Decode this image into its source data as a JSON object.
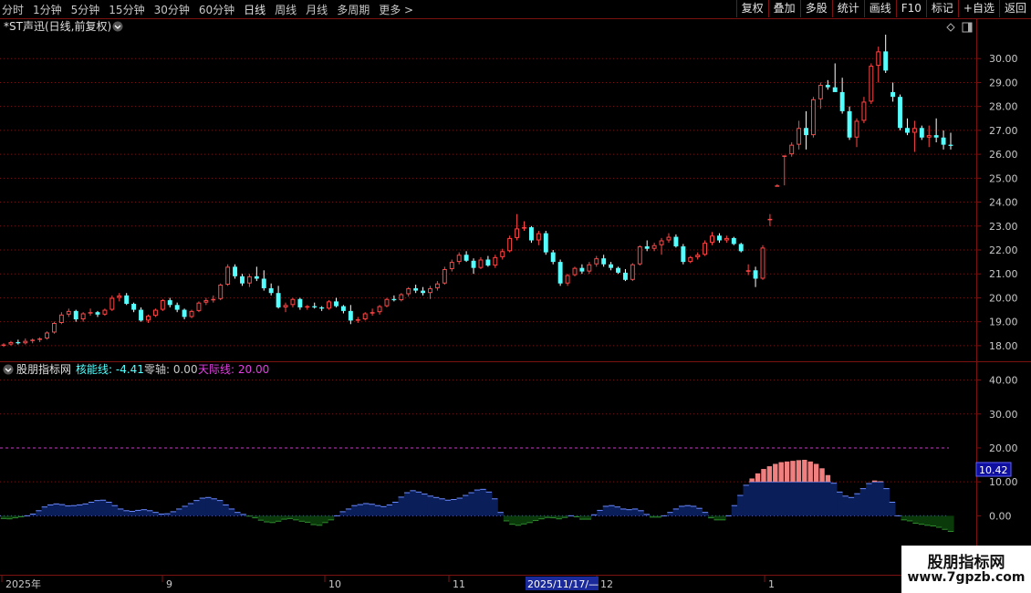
{
  "toolbar": {
    "periods": [
      "分时",
      "1分钟",
      "5分钟",
      "15分钟",
      "30分钟",
      "60分钟",
      "日线",
      "周线",
      "月线",
      "多周期",
      "更多"
    ],
    "active_period": "日线",
    "more_arrow": "更多 >",
    "buttons": [
      "复权",
      "叠加",
      "多股",
      "统计",
      "画线",
      "F10",
      "标记",
      "+自选",
      "返回"
    ]
  },
  "price_panel": {
    "title": "*ST声迅(日线,前复权)",
    "y_ticks": [
      "30.00",
      "29.00",
      "28.00",
      "27.00",
      "26.00",
      "25.00",
      "24.00",
      "23.00",
      "22.00",
      "21.00",
      "20.00",
      "19.00",
      "18.00"
    ]
  },
  "indicator_panel": {
    "name": "股朋指标网",
    "line1_label": "核能线: -4.41",
    "line2_label": "零轴: 0.00",
    "line3_label": "天际线: 20.00",
    "y_ticks": [
      "40.00",
      "30.00",
      "20.00",
      "10.00",
      "0.00"
    ],
    "current_value": "10.42"
  },
  "date_axis": {
    "labels": [
      "2025年",
      "9",
      "10",
      "11",
      "12",
      "1"
    ],
    "cursor_label": "2025/11/17/—"
  },
  "watermark": {
    "line1": "股朋指标网",
    "line2": "www.7gpzb.com"
  },
  "colors": {
    "up": "#ff4646",
    "down": "#54ffff",
    "grid": "#7a1212",
    "skyline": "#c040c0",
    "positive_fill": "#0a1e5a",
    "green_fill": "#0a3a0a",
    "pink": "#f08080"
  },
  "chart_data": {
    "type": "candlestick",
    "x_start_label": "2025年",
    "ylim": [
      17.5,
      31.0
    ],
    "ohlc": [
      [
        18.0,
        18.1,
        17.95,
        18.05
      ],
      [
        18.05,
        18.2,
        18.0,
        18.15
      ],
      [
        18.15,
        18.25,
        18.05,
        18.1
      ],
      [
        18.1,
        18.3,
        18.05,
        18.2
      ],
      [
        18.2,
        18.3,
        18.1,
        18.25
      ],
      [
        18.25,
        18.35,
        18.15,
        18.3
      ],
      [
        18.3,
        18.6,
        18.25,
        18.55
      ],
      [
        18.55,
        19.0,
        18.5,
        18.95
      ],
      [
        18.95,
        19.4,
        18.9,
        19.3
      ],
      [
        19.3,
        19.55,
        19.2,
        19.45
      ],
      [
        19.45,
        19.5,
        19.0,
        19.1
      ],
      [
        19.1,
        19.4,
        19.0,
        19.35
      ],
      [
        19.35,
        19.55,
        19.25,
        19.4
      ],
      [
        19.4,
        19.45,
        19.2,
        19.3
      ],
      [
        19.3,
        19.55,
        19.25,
        19.5
      ],
      [
        19.5,
        20.1,
        19.45,
        20.0
      ],
      [
        20.0,
        20.2,
        19.85,
        20.1
      ],
      [
        20.1,
        20.2,
        19.7,
        19.75
      ],
      [
        19.75,
        19.8,
        19.4,
        19.5
      ],
      [
        19.5,
        19.6,
        19.0,
        19.05
      ],
      [
        19.05,
        19.3,
        18.95,
        19.25
      ],
      [
        19.25,
        19.55,
        19.2,
        19.5
      ],
      [
        19.5,
        19.95,
        19.45,
        19.9
      ],
      [
        19.9,
        20.0,
        19.6,
        19.7
      ],
      [
        19.7,
        19.8,
        19.4,
        19.5
      ],
      [
        19.5,
        19.55,
        19.1,
        19.2
      ],
      [
        19.2,
        19.5,
        19.15,
        19.45
      ],
      [
        19.45,
        19.85,
        19.4,
        19.8
      ],
      [
        19.8,
        20.0,
        19.7,
        19.9
      ],
      [
        19.9,
        20.1,
        19.8,
        19.95
      ],
      [
        19.95,
        20.6,
        19.9,
        20.55
      ],
      [
        20.55,
        21.4,
        20.5,
        21.3
      ],
      [
        21.3,
        21.4,
        20.8,
        20.9
      ],
      [
        20.9,
        21.0,
        20.5,
        20.6
      ],
      [
        20.6,
        21.0,
        20.45,
        20.9
      ],
      [
        20.9,
        21.3,
        20.7,
        20.8
      ],
      [
        20.8,
        21.15,
        20.3,
        20.4
      ],
      [
        20.4,
        20.6,
        20.1,
        20.2
      ],
      [
        20.2,
        20.5,
        19.55,
        19.6
      ],
      [
        19.6,
        19.8,
        19.4,
        19.7
      ],
      [
        19.7,
        20.0,
        19.6,
        19.95
      ],
      [
        19.95,
        20.0,
        19.5,
        19.6
      ],
      [
        19.6,
        19.7,
        19.5,
        19.65
      ],
      [
        19.65,
        19.8,
        19.55,
        19.6
      ],
      [
        19.6,
        19.65,
        19.45,
        19.55
      ],
      [
        19.55,
        19.9,
        19.5,
        19.85
      ],
      [
        19.85,
        20.0,
        19.6,
        19.65
      ],
      [
        19.65,
        19.7,
        19.35,
        19.45
      ],
      [
        19.45,
        19.7,
        18.9,
        19.05
      ],
      [
        19.05,
        19.2,
        18.95,
        19.1
      ],
      [
        19.1,
        19.4,
        19.05,
        19.35
      ],
      [
        19.35,
        19.55,
        19.25,
        19.4
      ],
      [
        19.4,
        19.7,
        19.3,
        19.65
      ],
      [
        19.65,
        20.0,
        19.6,
        19.95
      ],
      [
        19.95,
        20.1,
        19.85,
        19.9
      ],
      [
        19.9,
        20.2,
        19.85,
        20.15
      ],
      [
        20.15,
        20.45,
        20.05,
        20.4
      ],
      [
        20.4,
        20.55,
        20.2,
        20.3
      ],
      [
        20.3,
        20.45,
        20.1,
        20.2
      ],
      [
        20.2,
        20.5,
        19.95,
        20.4
      ],
      [
        20.4,
        20.7,
        20.3,
        20.6
      ],
      [
        20.6,
        21.3,
        20.55,
        21.2
      ],
      [
        21.2,
        21.6,
        21.1,
        21.5
      ],
      [
        21.5,
        21.9,
        21.4,
        21.8
      ],
      [
        21.8,
        21.95,
        21.5,
        21.55
      ],
      [
        21.55,
        21.65,
        21.0,
        21.25
      ],
      [
        21.25,
        21.7,
        21.2,
        21.6
      ],
      [
        21.6,
        21.75,
        21.3,
        21.35
      ],
      [
        21.35,
        21.8,
        21.25,
        21.7
      ],
      [
        21.7,
        22.05,
        21.6,
        21.95
      ],
      [
        21.95,
        22.6,
        21.9,
        22.5
      ],
      [
        22.5,
        23.5,
        22.4,
        22.9
      ],
      [
        22.9,
        23.2,
        22.8,
        22.95
      ],
      [
        22.95,
        23.0,
        22.3,
        22.4
      ],
      [
        22.4,
        22.8,
        22.2,
        22.7
      ],
      [
        22.7,
        22.8,
        21.8,
        21.9
      ],
      [
        21.9,
        22.0,
        21.4,
        21.5
      ],
      [
        21.5,
        21.6,
        20.5,
        20.6
      ],
      [
        20.6,
        21.0,
        20.5,
        20.95
      ],
      [
        20.95,
        21.3,
        20.9,
        21.25
      ],
      [
        21.25,
        21.4,
        21.0,
        21.1
      ],
      [
        21.1,
        21.5,
        21.0,
        21.4
      ],
      [
        21.4,
        21.75,
        21.3,
        21.65
      ],
      [
        21.65,
        21.8,
        21.3,
        21.4
      ],
      [
        21.4,
        21.5,
        21.15,
        21.25
      ],
      [
        21.25,
        21.3,
        21.0,
        21.05
      ],
      [
        21.05,
        21.2,
        20.7,
        20.75
      ],
      [
        20.75,
        21.45,
        20.7,
        21.4
      ],
      [
        21.4,
        22.2,
        21.35,
        22.15
      ],
      [
        22.15,
        22.4,
        21.95,
        22.05
      ],
      [
        22.05,
        22.3,
        21.95,
        22.2
      ],
      [
        22.2,
        22.5,
        21.8,
        22.4
      ],
      [
        22.4,
        22.7,
        22.3,
        22.55
      ],
      [
        22.55,
        22.65,
        22.1,
        22.15
      ],
      [
        22.15,
        22.25,
        21.4,
        21.5
      ],
      [
        21.5,
        21.75,
        21.45,
        21.7
      ],
      [
        21.7,
        21.9,
        21.6,
        21.8
      ],
      [
        21.8,
        22.4,
        21.75,
        22.3
      ],
      [
        22.3,
        22.75,
        22.2,
        22.6
      ],
      [
        22.6,
        22.7,
        22.3,
        22.4
      ],
      [
        22.4,
        22.6,
        22.3,
        22.5
      ],
      [
        22.5,
        22.55,
        22.2,
        22.25
      ],
      [
        22.25,
        22.3,
        21.9,
        21.95
      ],
      [
        21.1,
        21.4,
        20.95,
        21.15
      ],
      [
        21.15,
        21.3,
        20.45,
        20.8
      ],
      [
        20.8,
        22.2,
        20.75,
        22.1
      ],
      [
        23.3,
        23.5,
        23.0,
        23.3
      ],
      [
        24.7,
        24.75,
        24.65,
        24.7
      ],
      [
        25.9,
        25.95,
        24.7,
        25.95
      ],
      [
        26.0,
        26.5,
        25.9,
        26.4
      ],
      [
        26.4,
        27.4,
        26.2,
        27.1
      ],
      [
        27.1,
        27.8,
        26.2,
        26.8
      ],
      [
        26.8,
        28.4,
        26.7,
        28.3
      ],
      [
        28.3,
        29.0,
        27.9,
        28.9
      ],
      [
        28.9,
        29.1,
        28.7,
        28.8
      ],
      [
        28.8,
        29.8,
        28.7,
        28.6
      ],
      [
        28.6,
        29.2,
        27.7,
        27.8
      ],
      [
        27.8,
        28.0,
        26.6,
        26.7
      ],
      [
        26.7,
        27.5,
        26.3,
        27.4
      ],
      [
        27.4,
        28.4,
        27.3,
        28.2
      ],
      [
        28.2,
        29.8,
        28.1,
        29.7
      ],
      [
        29.7,
        30.5,
        29.0,
        30.3
      ],
      [
        30.3,
        31.0,
        29.4,
        29.5
      ],
      [
        28.6,
        29.0,
        28.2,
        28.4
      ],
      [
        28.4,
        28.5,
        27.0,
        27.1
      ],
      [
        27.1,
        27.5,
        26.8,
        26.9
      ],
      [
        26.9,
        27.4,
        26.1,
        27.1
      ],
      [
        27.1,
        27.2,
        26.6,
        26.7
      ],
      [
        26.7,
        27.2,
        26.3,
        26.8
      ],
      [
        26.8,
        27.5,
        26.5,
        26.7
      ],
      [
        26.7,
        27.0,
        26.2,
        26.4
      ],
      [
        26.4,
        26.9,
        26.2,
        26.35
      ]
    ],
    "indicator": [
      -0.8,
      -0.9,
      -0.6,
      -0.3,
      0.0,
      0.5,
      1.5,
      2.6,
      3.2,
      3.5,
      3.3,
      2.9,
      3.0,
      3.2,
      3.5,
      4.0,
      4.5,
      4.6,
      4.0,
      3.0,
      2.0,
      1.5,
      1.3,
      1.6,
      1.8,
      1.5,
      1.0,
      0.5,
      0.6,
      1.2,
      2.0,
      2.8,
      3.6,
      4.5,
      5.2,
      5.4,
      5.0,
      4.5,
      3.2,
      2.0,
      1.0,
      0.4,
      -0.1,
      -0.6,
      -1.3,
      -1.8,
      -2.0,
      -1.6,
      -1.0,
      -0.8,
      -1.2,
      -1.6,
      -1.9,
      -2.6,
      -2.8,
      -2.0,
      -1.2,
      0.0,
      1.2,
      2.0,
      3.0,
      3.3,
      3.6,
      3.4,
      3.0,
      2.7,
      3.2,
      4.0,
      5.5,
      6.8,
      7.4,
      7.0,
      6.4,
      5.8,
      5.4,
      5.0,
      4.6,
      4.8,
      5.2,
      6.0,
      6.8,
      7.6,
      7.8,
      7.0,
      5.0,
      1.0,
      -1.5,
      -2.5,
      -2.8,
      -2.4,
      -2.0,
      -1.4,
      -0.9,
      -0.5,
      -0.6,
      -0.9,
      -0.5,
      0.0,
      -0.3,
      -1.0,
      -1.0,
      0.3,
      1.6,
      2.8,
      3.0,
      2.6,
      2.0,
      1.8,
      2.0,
      1.5,
      0.4,
      -0.4,
      -0.4,
      0.0,
      1.0,
      2.0,
      2.8,
      3.0,
      2.8,
      2.2,
      1.0,
      -0.6,
      -1.2,
      -1.2,
      0.0,
      3.0,
      6.0,
      9.0,
      11.0,
      12.5,
      13.8,
      14.6,
      15.3,
      15.8,
      16.0,
      16.2,
      16.4,
      16.5,
      16.0,
      15.3,
      14.0,
      12.0,
      9.6,
      7.0,
      5.8,
      5.4,
      6.5,
      8.0,
      9.5,
      10.4,
      10.2,
      8.0,
      4.0,
      0.0,
      -1.2,
      -1.5,
      -2.2,
      -2.5,
      -2.8,
      -3.0,
      -3.4,
      -4.0,
      -4.6
    ],
    "indicator_ylim": [
      -12,
      45
    ],
    "skyline": 20,
    "zero": 0
  }
}
